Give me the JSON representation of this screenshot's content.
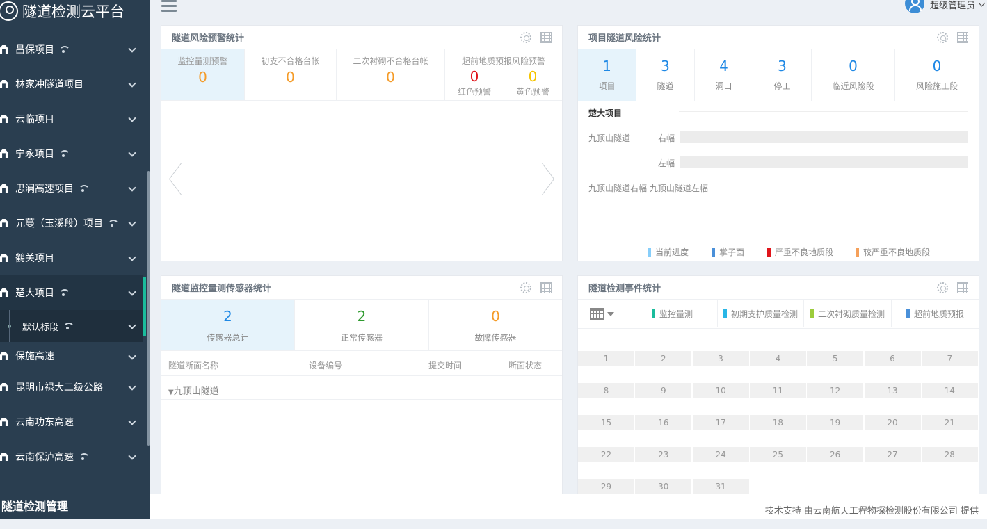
{
  "app": {
    "title": "隧道检测云平台"
  },
  "user": {
    "name": "超级管理员"
  },
  "sidebar": {
    "items": [
      {
        "label": "昌保项目",
        "wifi": true
      },
      {
        "label": "林家冲隧道项目",
        "wifi": false
      },
      {
        "label": "云临项目",
        "wifi": false
      },
      {
        "label": "宁永项目",
        "wifi": true
      },
      {
        "label": "思澜高速项目",
        "wifi": true
      },
      {
        "label": "元蔓（玉溪段）项目",
        "wifi": true
      },
      {
        "label": "鹤关项目",
        "wifi": false
      },
      {
        "label": "楚大项目",
        "wifi": true,
        "active": true
      },
      {
        "label": "保施高速",
        "wifi": false
      },
      {
        "label": "昆明市禄大二级公路",
        "wifi": false
      },
      {
        "label": "云南功东高速",
        "wifi": false
      },
      {
        "label": "云南保泸高速",
        "wifi": true
      }
    ],
    "subitem": {
      "label": "默认标段"
    },
    "footer": "隧道检测管理"
  },
  "risk_panel": {
    "title": "隧道风险预警统计",
    "stats": [
      {
        "label": "监控量测预警",
        "value": "0"
      },
      {
        "label": "初支不合格台帐",
        "value": "0"
      },
      {
        "label": "二次衬砌不合格台帐",
        "value": "0"
      }
    ],
    "forecast": {
      "label": "超前地质预报风险预警",
      "red": {
        "value": "0",
        "label": "红色预警",
        "color": "#e0151b"
      },
      "yellow": {
        "value": "0",
        "label": "黄色预警",
        "color": "#f5c400"
      }
    }
  },
  "project_panel": {
    "title": "项目隧道风险统计",
    "stats": [
      {
        "value": "1",
        "label": "项目"
      },
      {
        "value": "3",
        "label": "隧道"
      },
      {
        "value": "4",
        "label": "洞口"
      },
      {
        "value": "3",
        "label": "停工"
      },
      {
        "value": "0",
        "label": "临近风险段"
      },
      {
        "value": "0",
        "label": "风险施工段"
      }
    ],
    "project_name": "楚大项目",
    "tunnel_name": "九顶山隧道",
    "right_label": "右幅",
    "left_label": "左幅",
    "tags": "九顶山隧道右幅 九顶山隧道左幅",
    "legend": [
      {
        "label": "当前进度",
        "color": "#87cefa"
      },
      {
        "label": "掌子面",
        "color": "#4a90d9"
      },
      {
        "label": "严重不良地质段",
        "color": "#e0151b"
      },
      {
        "label": "较严重不良地质段",
        "color": "#f5a05a"
      }
    ]
  },
  "sensor_panel": {
    "title": "隧道监控量测传感器统计",
    "stats": [
      {
        "value": "2",
        "label": "传感器总计",
        "color": "#1e88e5"
      },
      {
        "value": "2",
        "label": "正常传感器",
        "color": "#2e9a2e"
      },
      {
        "value": "0",
        "label": "故障传感器",
        "color": "#f59b27"
      }
    ],
    "columns": [
      "隧道断面名称",
      "设备编号",
      "提交时间",
      "断面状态"
    ],
    "group": "九顶山隧道"
  },
  "event_panel": {
    "title": "隧道检测事件统计",
    "tabs": [
      {
        "label": "监控量测",
        "color": "#1abc9c"
      },
      {
        "label": "初期支护质量检测",
        "color": "#29b6e6"
      },
      {
        "label": "二次衬砌质量检测",
        "color": "#9ccc3c"
      },
      {
        "label": "超前地质预报",
        "color": "#4a90d9"
      }
    ],
    "days": [
      "1",
      "2",
      "3",
      "4",
      "5",
      "6",
      "7",
      "8",
      "9",
      "10",
      "11",
      "12",
      "13",
      "14",
      "15",
      "16",
      "17",
      "18",
      "19",
      "20",
      "21",
      "22",
      "23",
      "24",
      "25",
      "26",
      "27",
      "28",
      "29",
      "30",
      "31"
    ]
  },
  "footer": {
    "text": "技术支持 由云南航天工程物探检测股份有限公司 提供"
  }
}
